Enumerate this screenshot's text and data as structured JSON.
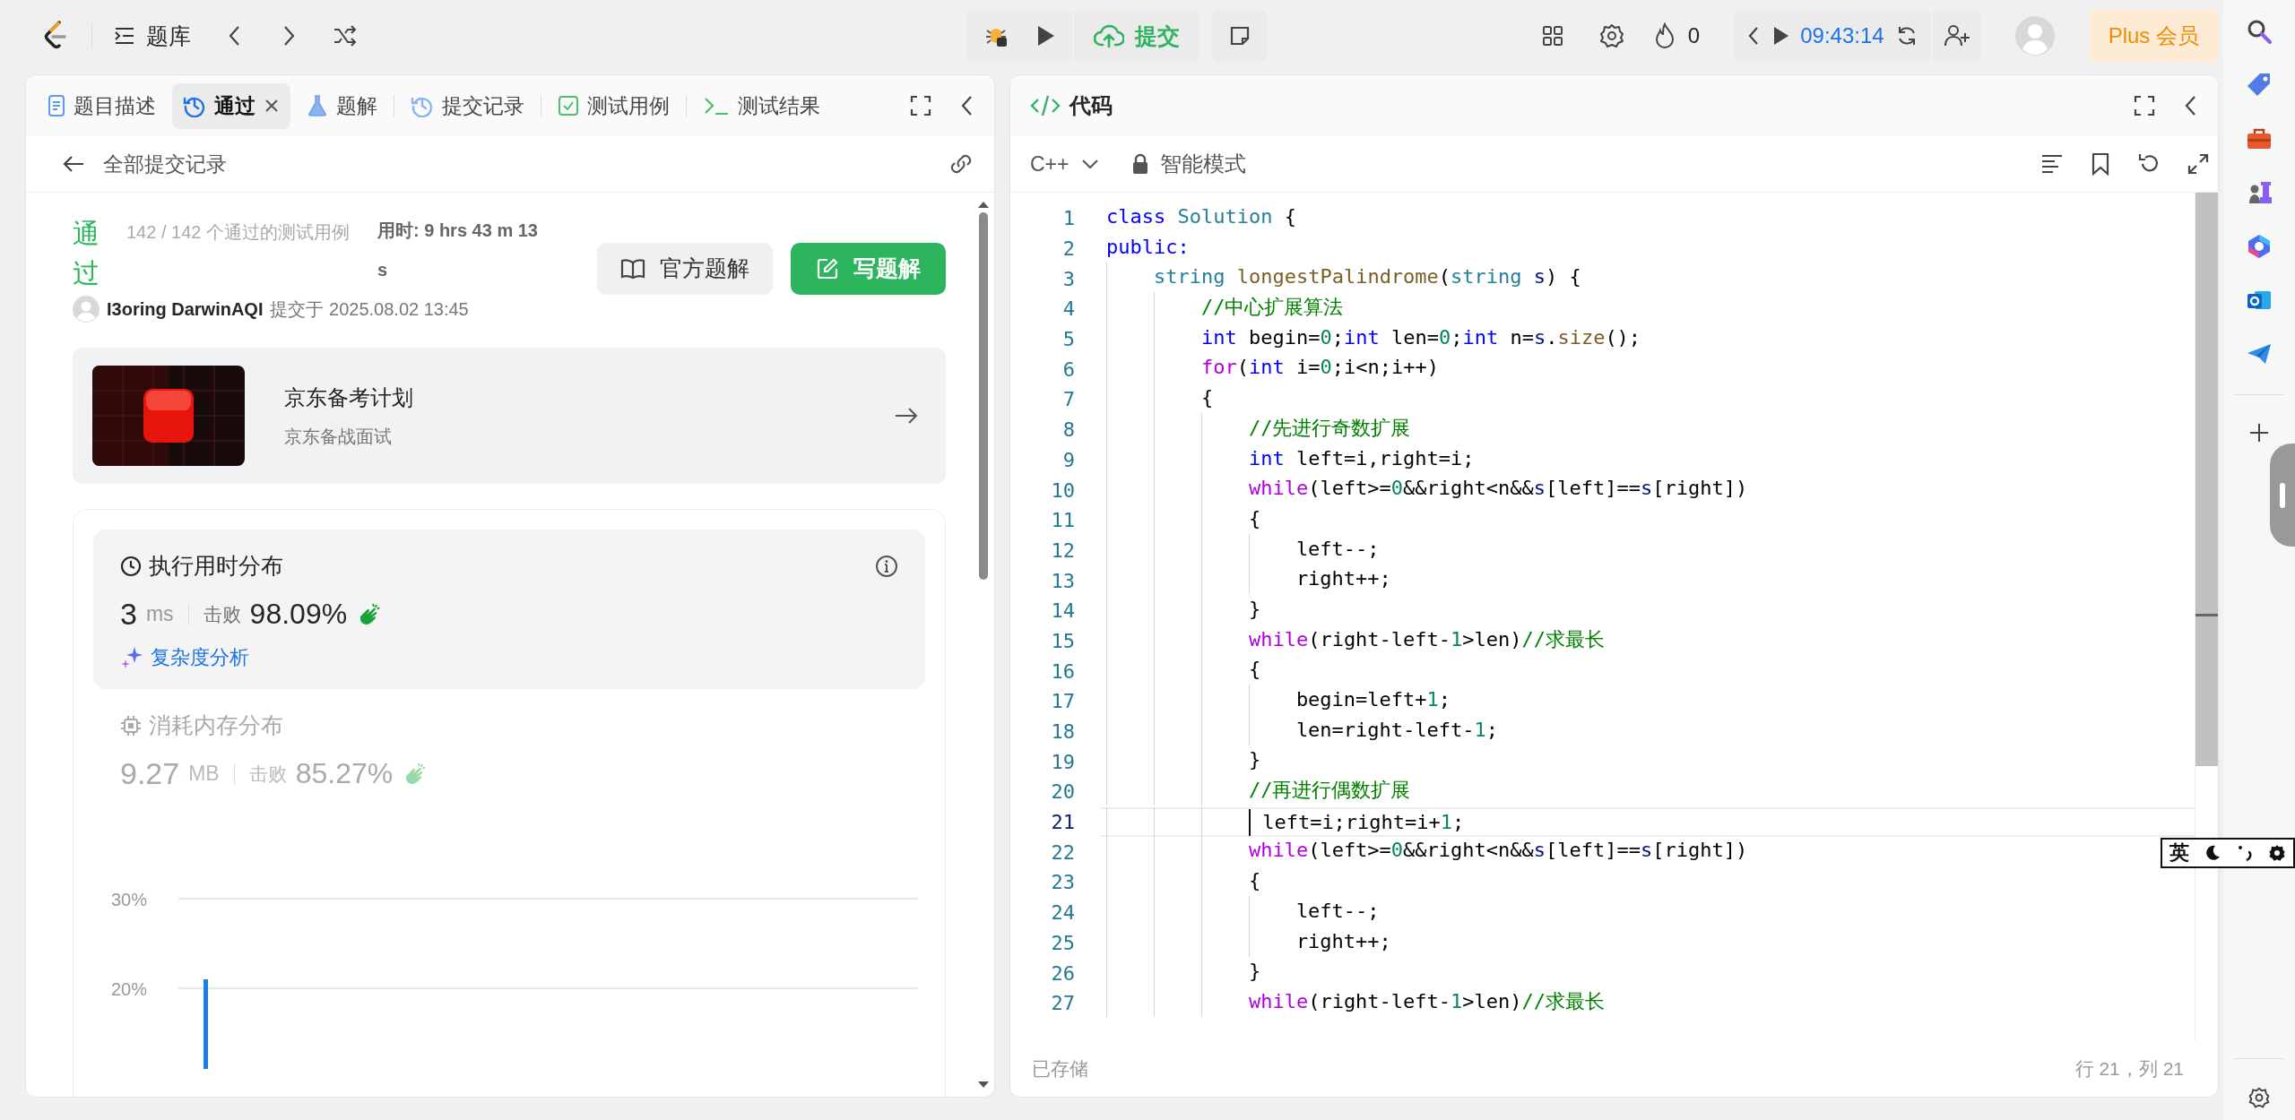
{
  "top_bar": {
    "problem_bank": "题库",
    "submit": "提交",
    "streak": "0",
    "timer": "09:43:14",
    "plus": "Plus 会员"
  },
  "left_panel": {
    "tabs": [
      {
        "label": "题目描述",
        "kind": "description",
        "selected": false,
        "closable": false
      },
      {
        "label": "通过",
        "kind": "history",
        "selected": true,
        "closable": true
      },
      {
        "label": "题解",
        "kind": "solution",
        "selected": false,
        "closable": false
      },
      {
        "label": "提交记录",
        "kind": "history",
        "selected": false,
        "closable": false
      },
      {
        "label": "测试用例",
        "kind": "testcase",
        "selected": false,
        "closable": false
      },
      {
        "label": "测试结果",
        "kind": "result",
        "selected": false,
        "closable": false
      }
    ],
    "back_label": "全部提交记录",
    "result": {
      "status": "通过",
      "cases": "142 / 142 个通过的测试用例",
      "runtime": "用时: 9 hrs 43 m 13 s",
      "author": "I3oring DarwinAQI",
      "submitted": "提交于 2025.08.02 13:45",
      "official_button": "官方题解",
      "write_button": "写题解"
    },
    "promo": {
      "title": "京东备考计划",
      "subtitle": "京东备战面试"
    },
    "runtime_card": {
      "title": "执行用时分布",
      "value": "3",
      "unit": "ms",
      "beat_label": "击败",
      "beat": "98.09%",
      "link": "复杂度分析",
      "selected": true
    },
    "memory_card": {
      "title": "消耗内存分布",
      "value": "9.27",
      "unit": "MB",
      "beat_label": "击败",
      "beat": "85.27%",
      "selected": false
    },
    "chart_data": {
      "type": "bar",
      "ylim": [
        11,
        30
      ],
      "yticks": [
        {
          "value": 20,
          "label": "20%"
        },
        {
          "value": 30,
          "label": "30%"
        }
      ],
      "values": [
        21
      ]
    }
  },
  "code_panel": {
    "title": "代码",
    "language": "C++",
    "mode": "智能模式",
    "lines": [
      {
        "number": "1",
        "current": false,
        "tokens": [
          {
            "kind": "kw",
            "text": "class "
          },
          {
            "kind": "type",
            "text": "Solution"
          },
          {
            "kind": "plain",
            "text": " {"
          }
        ]
      },
      {
        "number": "2",
        "current": false,
        "tokens": [
          {
            "kind": "kw",
            "text": "public:"
          }
        ]
      },
      {
        "number": "3",
        "current": false,
        "tokens": [
          {
            "kind": "type",
            "text": "    string "
          },
          {
            "kind": "fn",
            "text": "longestPalindrome"
          },
          {
            "kind": "plain",
            "text": "("
          },
          {
            "kind": "type",
            "text": "string "
          },
          {
            "kind": "var",
            "text": "s"
          },
          {
            "kind": "plain",
            "text": ") {"
          }
        ]
      },
      {
        "number": "4",
        "current": false,
        "tokens": [
          {
            "kind": "comment",
            "text": "        //中心扩展算法"
          }
        ]
      },
      {
        "number": "5",
        "current": false,
        "tokens": [
          {
            "kind": "kw",
            "text": "        int"
          },
          {
            "kind": "plain",
            "text": " begin="
          },
          {
            "kind": "num",
            "text": "0"
          },
          {
            "kind": "plain",
            "text": ";"
          },
          {
            "kind": "kw",
            "text": "int"
          },
          {
            "kind": "plain",
            "text": " len="
          },
          {
            "kind": "num",
            "text": "0"
          },
          {
            "kind": "plain",
            "text": ";"
          },
          {
            "kind": "kw",
            "text": "int"
          },
          {
            "kind": "plain",
            "text": " n="
          },
          {
            "kind": "var",
            "text": "s"
          },
          {
            "kind": "plain",
            "text": "."
          },
          {
            "kind": "fn",
            "text": "size"
          },
          {
            "kind": "plain",
            "text": "();"
          }
        ]
      },
      {
        "number": "6",
        "current": false,
        "tokens": [
          {
            "kind": "ctrl",
            "text": "        for"
          },
          {
            "kind": "plain",
            "text": "("
          },
          {
            "kind": "kw",
            "text": "int"
          },
          {
            "kind": "plain",
            "text": " i="
          },
          {
            "kind": "num",
            "text": "0"
          },
          {
            "kind": "plain",
            "text": ";i<n;i++)"
          }
        ]
      },
      {
        "number": "7",
        "current": false,
        "tokens": [
          {
            "kind": "plain",
            "text": "        {"
          }
        ]
      },
      {
        "number": "8",
        "current": false,
        "tokens": [
          {
            "kind": "comment",
            "text": "            //先进行奇数扩展"
          }
        ]
      },
      {
        "number": "9",
        "current": false,
        "tokens": [
          {
            "kind": "kw",
            "text": "            int"
          },
          {
            "kind": "plain",
            "text": " left=i,right=i;"
          }
        ]
      },
      {
        "number": "10",
        "current": false,
        "tokens": [
          {
            "kind": "ctrl",
            "text": "            while"
          },
          {
            "kind": "plain",
            "text": "(left>="
          },
          {
            "kind": "num",
            "text": "0"
          },
          {
            "kind": "plain",
            "text": "&&right<n&&"
          },
          {
            "kind": "var",
            "text": "s"
          },
          {
            "kind": "plain",
            "text": "[left]=="
          },
          {
            "kind": "var",
            "text": "s"
          },
          {
            "kind": "plain",
            "text": "[right])"
          }
        ]
      },
      {
        "number": "11",
        "current": false,
        "tokens": [
          {
            "kind": "plain",
            "text": "            {"
          }
        ]
      },
      {
        "number": "12",
        "current": false,
        "tokens": [
          {
            "kind": "plain",
            "text": "                left--;"
          }
        ]
      },
      {
        "number": "13",
        "current": false,
        "tokens": [
          {
            "kind": "plain",
            "text": "                right++;"
          }
        ]
      },
      {
        "number": "14",
        "current": false,
        "tokens": [
          {
            "kind": "plain",
            "text": "            }"
          }
        ]
      },
      {
        "number": "15",
        "current": false,
        "tokens": [
          {
            "kind": "ctrl",
            "text": "            while"
          },
          {
            "kind": "plain",
            "text": "(right-left-"
          },
          {
            "kind": "num",
            "text": "1"
          },
          {
            "kind": "plain",
            "text": ">len)"
          },
          {
            "kind": "comment",
            "text": "//求最长"
          }
        ]
      },
      {
        "number": "16",
        "current": false,
        "tokens": [
          {
            "kind": "plain",
            "text": "            {"
          }
        ]
      },
      {
        "number": "17",
        "current": false,
        "tokens": [
          {
            "kind": "plain",
            "text": "                begin=left+"
          },
          {
            "kind": "num",
            "text": "1"
          },
          {
            "kind": "plain",
            "text": ";"
          }
        ]
      },
      {
        "number": "18",
        "current": false,
        "tokens": [
          {
            "kind": "plain",
            "text": "                len=right-left-"
          },
          {
            "kind": "num",
            "text": "1"
          },
          {
            "kind": "plain",
            "text": ";"
          }
        ]
      },
      {
        "number": "19",
        "current": false,
        "tokens": [
          {
            "kind": "plain",
            "text": "            }"
          }
        ]
      },
      {
        "number": "20",
        "current": false,
        "tokens": [
          {
            "kind": "comment",
            "text": "            //再进行偶数扩展"
          }
        ]
      },
      {
        "number": "21",
        "current": true,
        "tokens": [
          {
            "kind": "plain",
            "text": "             left=i;right=i+"
          },
          {
            "kind": "num",
            "text": "1"
          },
          {
            "kind": "plain",
            "text": ";"
          }
        ]
      },
      {
        "number": "22",
        "current": false,
        "tokens": [
          {
            "kind": "ctrl",
            "text": "            while"
          },
          {
            "kind": "plain",
            "text": "(left>="
          },
          {
            "kind": "num",
            "text": "0"
          },
          {
            "kind": "plain",
            "text": "&&right<n&&"
          },
          {
            "kind": "var",
            "text": "s"
          },
          {
            "kind": "plain",
            "text": "[left]=="
          },
          {
            "kind": "var",
            "text": "s"
          },
          {
            "kind": "plain",
            "text": "[right])"
          }
        ]
      },
      {
        "number": "23",
        "current": false,
        "tokens": [
          {
            "kind": "plain",
            "text": "            {"
          }
        ]
      },
      {
        "number": "24",
        "current": false,
        "tokens": [
          {
            "kind": "plain",
            "text": "                left--;"
          }
        ]
      },
      {
        "number": "25",
        "current": false,
        "tokens": [
          {
            "kind": "plain",
            "text": "                right++;"
          }
        ]
      },
      {
        "number": "26",
        "current": false,
        "tokens": [
          {
            "kind": "plain",
            "text": "            }"
          }
        ]
      },
      {
        "number": "27",
        "current": false,
        "tokens": [
          {
            "kind": "ctrl",
            "text": "            while"
          },
          {
            "kind": "plain",
            "text": "(right-left-"
          },
          {
            "kind": "num",
            "text": "1"
          },
          {
            "kind": "plain",
            "text": ">len)"
          },
          {
            "kind": "comment",
            "text": "//求最长"
          }
        ]
      }
    ],
    "saved_status": "已存储",
    "cursor_position": "行 21，列 21"
  },
  "ime_bar": {
    "mode": "英"
  }
}
